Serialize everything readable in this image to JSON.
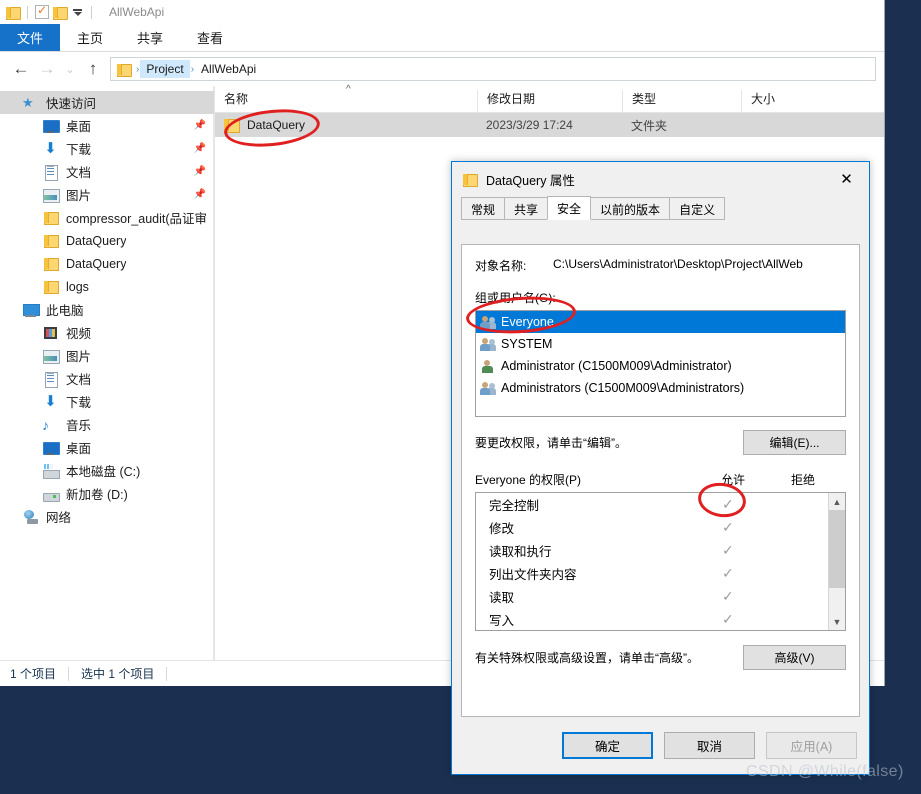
{
  "window": {
    "title": "AllWebApi",
    "quick_access_icons": [
      "folder-icon",
      "properties-icon",
      "folder-icon",
      "chevron-down-icon"
    ]
  },
  "ribbon": {
    "tabs": [
      {
        "label": "文件",
        "active": true
      },
      {
        "label": "主页",
        "active": false
      },
      {
        "label": "共享",
        "active": false
      },
      {
        "label": "查看",
        "active": false
      }
    ]
  },
  "addressbar": {
    "back_icon": "back-arrow-icon",
    "forward_icon": "forward-arrow-icon",
    "history_icon": "chevron-down-icon",
    "up_icon": "up-arrow-icon",
    "crumbs": [
      "Project",
      "AllWebApi"
    ],
    "separator": "›"
  },
  "nav_pane": {
    "items": [
      {
        "label": "快速访问",
        "icon": "star-icon",
        "indent": 0,
        "selected": true,
        "pinned": false
      },
      {
        "label": "桌面",
        "icon": "desktop-icon",
        "indent": 1,
        "selected": false,
        "pinned": true
      },
      {
        "label": "下载",
        "icon": "download-icon",
        "indent": 1,
        "selected": false,
        "pinned": true
      },
      {
        "label": "文档",
        "icon": "document-icon",
        "indent": 1,
        "selected": false,
        "pinned": true
      },
      {
        "label": "图片",
        "icon": "picture-icon",
        "indent": 1,
        "selected": false,
        "pinned": true
      },
      {
        "label": "compressor_audit(品证审核",
        "icon": "folder-icon",
        "indent": 1,
        "selected": false,
        "pinned": false
      },
      {
        "label": "DataQuery",
        "icon": "folder-icon",
        "indent": 1,
        "selected": false,
        "pinned": false
      },
      {
        "label": "DataQuery",
        "icon": "folder-icon",
        "indent": 1,
        "selected": false,
        "pinned": false
      },
      {
        "label": "logs",
        "icon": "folder-icon",
        "indent": 1,
        "selected": false,
        "pinned": false
      },
      {
        "label": "此电脑",
        "icon": "pc-icon",
        "indent": 0,
        "selected": false,
        "pinned": false
      },
      {
        "label": "视频",
        "icon": "video-icon",
        "indent": 1,
        "selected": false,
        "pinned": false
      },
      {
        "label": "图片",
        "icon": "picture-icon",
        "indent": 1,
        "selected": false,
        "pinned": false
      },
      {
        "label": "文档",
        "icon": "document-icon",
        "indent": 1,
        "selected": false,
        "pinned": false
      },
      {
        "label": "下载",
        "icon": "download-icon",
        "indent": 1,
        "selected": false,
        "pinned": false
      },
      {
        "label": "音乐",
        "icon": "music-icon",
        "indent": 1,
        "selected": false,
        "pinned": false
      },
      {
        "label": "桌面",
        "icon": "desktop-icon",
        "indent": 1,
        "selected": false,
        "pinned": false
      },
      {
        "label": "本地磁盘 (C:)",
        "icon": "local-disk-icon",
        "indent": 1,
        "selected": false,
        "pinned": false
      },
      {
        "label": "新加卷 (D:)",
        "icon": "hdd-icon",
        "indent": 1,
        "selected": false,
        "pinned": false
      },
      {
        "label": "网络",
        "icon": "network-icon",
        "indent": 0,
        "selected": false,
        "pinned": false
      }
    ]
  },
  "file_list": {
    "columns": [
      "名称",
      "修改日期",
      "类型",
      "大小"
    ],
    "sort_indicator": "^",
    "rows": [
      {
        "name": "DataQuery",
        "date": "2023/3/29 17:24",
        "type": "文件夹",
        "size": "",
        "selected": true,
        "icon": "folder-icon"
      }
    ]
  },
  "statusbar": {
    "count": "1 个项目",
    "selection": "选中 1 个项目"
  },
  "dialog": {
    "title": "DataQuery 属性",
    "icon": "folder-icon",
    "close_icon": "close-icon",
    "tabs": [
      {
        "label": "常规",
        "active": false
      },
      {
        "label": "共享",
        "active": false
      },
      {
        "label": "安全",
        "active": true
      },
      {
        "label": "以前的版本",
        "active": false
      },
      {
        "label": "自定义",
        "active": false
      }
    ],
    "object_name_label": "对象名称:",
    "object_name_value": "C:\\Users\\Administrator\\Desktop\\Project\\AllWeb",
    "group_label": "组或用户名(G):",
    "group_items": [
      {
        "label": "Everyone",
        "icon": "group-icon",
        "selected": true
      },
      {
        "label": "SYSTEM",
        "icon": "group-icon",
        "selected": false
      },
      {
        "label": "Administrator (C1500M009\\Administrator)",
        "icon": "user-icon",
        "selected": false
      },
      {
        "label": "Administrators (C1500M009\\Administrators)",
        "icon": "group-icon",
        "selected": false
      }
    ],
    "edit_hint": "要更改权限，请单击“编辑”。",
    "edit_button": "编辑(E)...",
    "permissions_label": "Everyone 的权限(P)",
    "allow_header": "允许",
    "deny_header": "拒绝",
    "permissions": [
      {
        "name": "完全控制",
        "allow": true,
        "deny": false
      },
      {
        "name": "修改",
        "allow": true,
        "deny": false
      },
      {
        "name": "读取和执行",
        "allow": true,
        "deny": false
      },
      {
        "name": "列出文件夹内容",
        "allow": true,
        "deny": false
      },
      {
        "name": "读取",
        "allow": true,
        "deny": false
      },
      {
        "name": "写入",
        "allow": true,
        "deny": false
      }
    ],
    "check_glyph": "✓",
    "advanced_hint": "有关特殊权限或高级设置，请单击“高级”。",
    "advanced_button": "高级(V)",
    "buttons": [
      {
        "label": "确定",
        "state": "default"
      },
      {
        "label": "取消",
        "state": "normal"
      },
      {
        "label": "应用(A)",
        "state": "disabled"
      }
    ]
  },
  "annotations": {
    "color": "#e02020",
    "marks": [
      "file-row-circle",
      "everyone-circle",
      "full-control-check-circle"
    ]
  },
  "watermark": "CSDN @While(false)"
}
